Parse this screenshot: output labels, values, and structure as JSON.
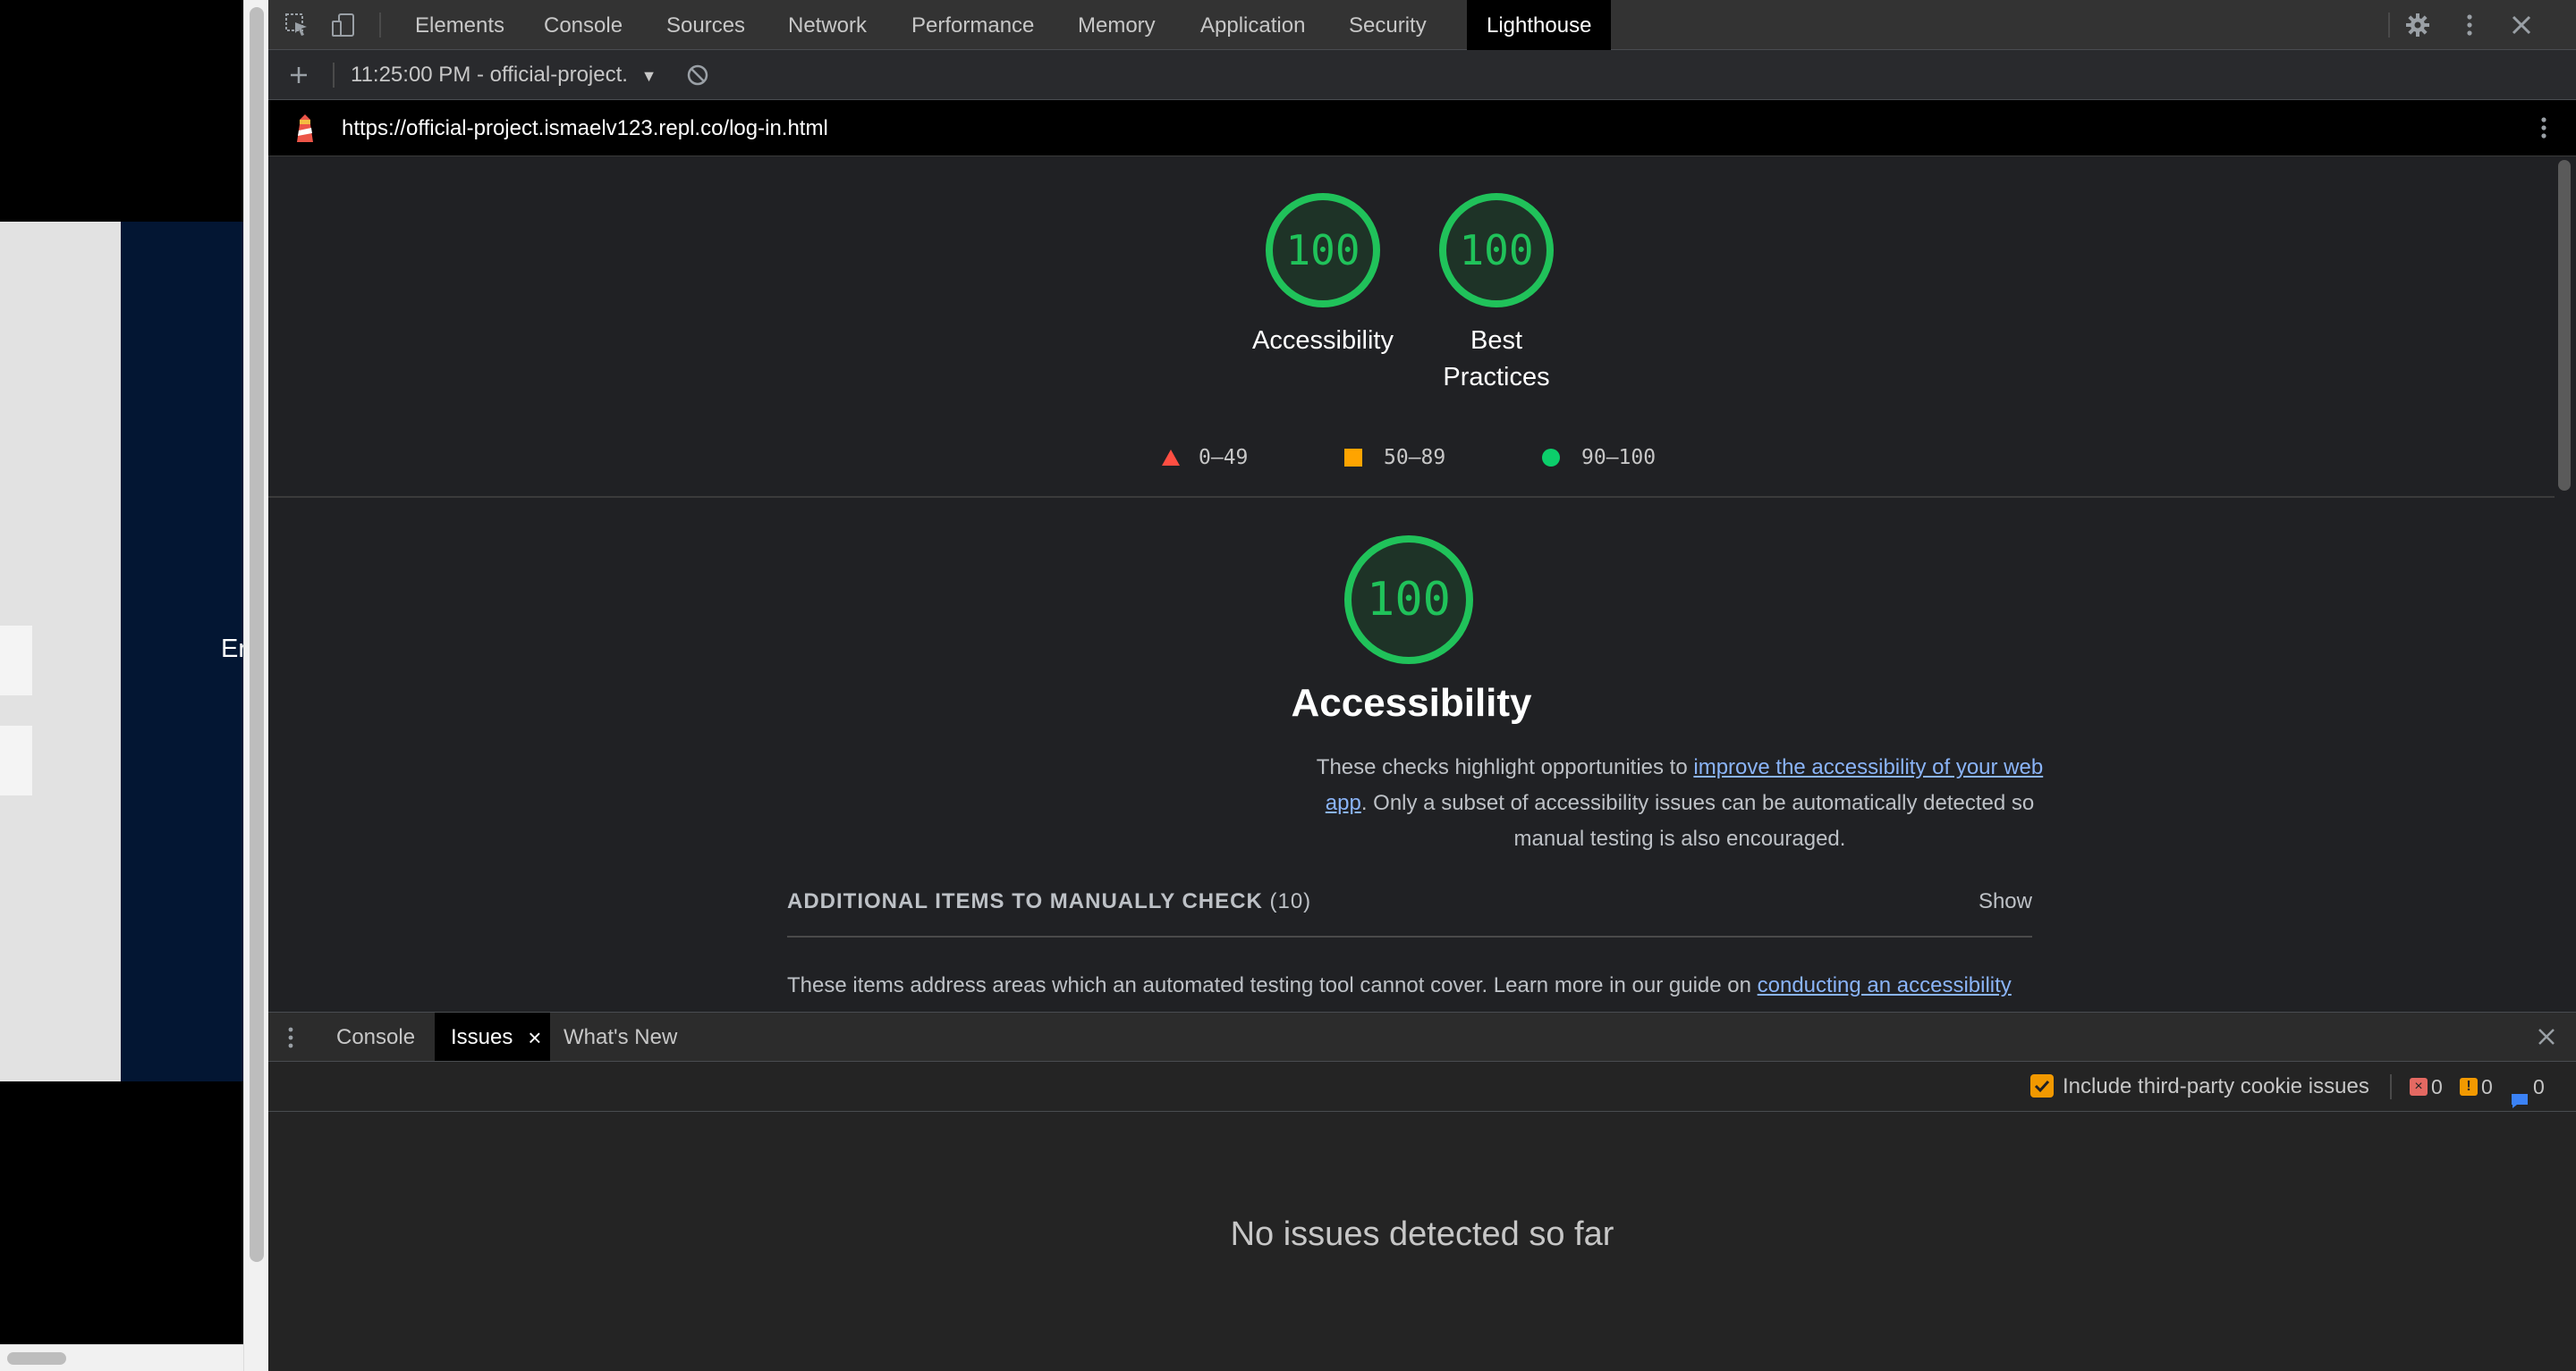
{
  "page_viewport": {
    "partial_text": "Er"
  },
  "devtools": {
    "main_tabs": [
      {
        "label": "Elements"
      },
      {
        "label": "Console"
      },
      {
        "label": "Sources"
      },
      {
        "label": "Network"
      },
      {
        "label": "Performance"
      },
      {
        "label": "Memory"
      },
      {
        "label": "Application"
      },
      {
        "label": "Security"
      },
      {
        "label": "Lighthouse"
      }
    ],
    "active_tab": "Lighthouse",
    "report_selector": "11:25:00 PM - official-project.",
    "url": "https://official-project.ismaelv123.repl.co/log-in.html",
    "gauges": [
      {
        "score": "100",
        "label": "Accessibility"
      },
      {
        "score": "100",
        "label": "Best Practices"
      }
    ],
    "legend": [
      {
        "range": "0–49",
        "color": "#ff4e42",
        "shape": "triangle"
      },
      {
        "range": "50–89",
        "color": "#ffa400",
        "shape": "square"
      },
      {
        "range": "90–100",
        "color": "#0cce6b",
        "shape": "circle"
      }
    ],
    "section": {
      "score": "100",
      "title": "Accessibility",
      "desc_before": "These checks highlight opportunities to ",
      "desc_link": "improve the accessibility of your web app",
      "desc_after": ". Only a subset of accessibility issues can be automatically detected so manual testing is also encouraged.",
      "manual_title": "ADDITIONAL ITEMS TO MANUALLY CHECK",
      "manual_count": "(10)",
      "manual_show": "Show",
      "manual_desc_before": "These items address areas which an automated testing tool cannot cover. Learn more in our guide on ",
      "manual_desc_link": "conducting an accessibility"
    },
    "drawer": {
      "tabs": [
        {
          "label": "Console"
        },
        {
          "label": "Issues"
        },
        {
          "label": "What's New"
        }
      ],
      "active_tab": "Issues",
      "cookie_checkbox_label": "Include third-party cookie issues",
      "cookie_checkbox_checked": true,
      "counts": {
        "errors": "0",
        "warnings": "0",
        "info": "0"
      },
      "empty_message": "No issues detected so far"
    },
    "colors": {
      "pass_green": "#20c25a",
      "link_blue": "#8ab4f8",
      "checkbox_orange": "#f29900"
    }
  }
}
